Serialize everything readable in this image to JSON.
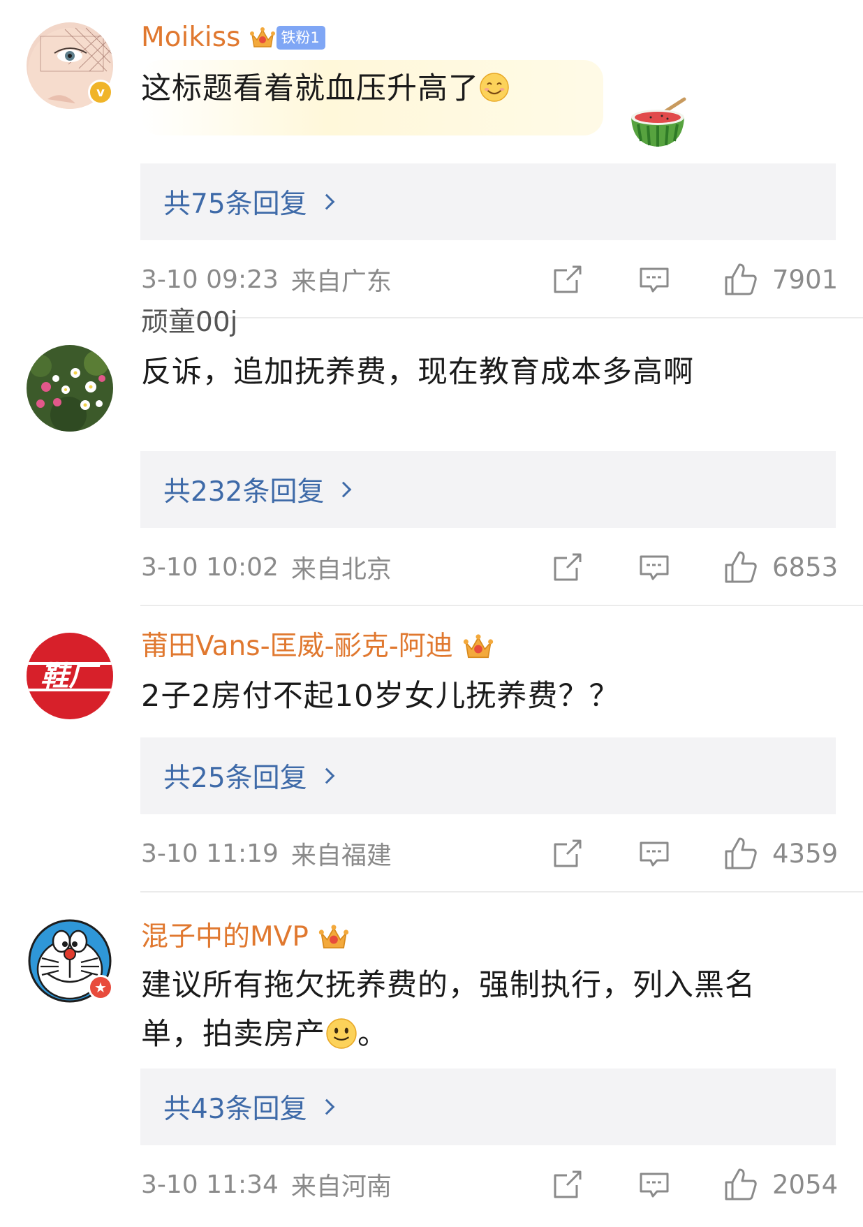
{
  "comments": [
    {
      "username": "Moikiss",
      "fan_badge": "铁粉1",
      "text": "这标题看着就血压升高了",
      "replies_label": "共75条回复",
      "time": "3-10 09:23",
      "location": "来自广东",
      "likes": "7901",
      "avatar_icon": "woman-face-avatar",
      "verified_color": "#f0b429"
    },
    {
      "username": "顽童00j",
      "text": "反诉，追加抚养费，现在教育成本多高啊",
      "replies_label": "共232条回复",
      "time": "3-10 10:02",
      "location": "来自北京",
      "likes": "6853",
      "avatar_icon": "flowers-avatar"
    },
    {
      "username": "莆田Vans-匡威-彨克-阿迪",
      "text": "2子2房付不起10岁女儿抚养费？？",
      "replies_label": "共25条回复",
      "time": "3-10 11:19",
      "location": "来自福建",
      "likes": "4359",
      "avatar_icon": "shoe-factory-logo-avatar",
      "avatar_text": "鞋厂"
    },
    {
      "username": "混子中的MVP",
      "text_line1": "建议所有拖欠抚养费的，强制执行，列入黑名",
      "text_line2": "单，拍卖房产",
      "text_line2_end": "。",
      "replies_label": "共43条回复",
      "time": "3-10 11:34",
      "location": "来自河南",
      "likes": "2054",
      "avatar_icon": "doraemon-avatar",
      "badge_color": "#e84b3c"
    }
  ],
  "colors": {
    "vip_name": "#e0782f",
    "reply_link": "#3e6aa8",
    "reply_bg": "#f3f3f5",
    "meta_gray": "#8a8a8a"
  }
}
